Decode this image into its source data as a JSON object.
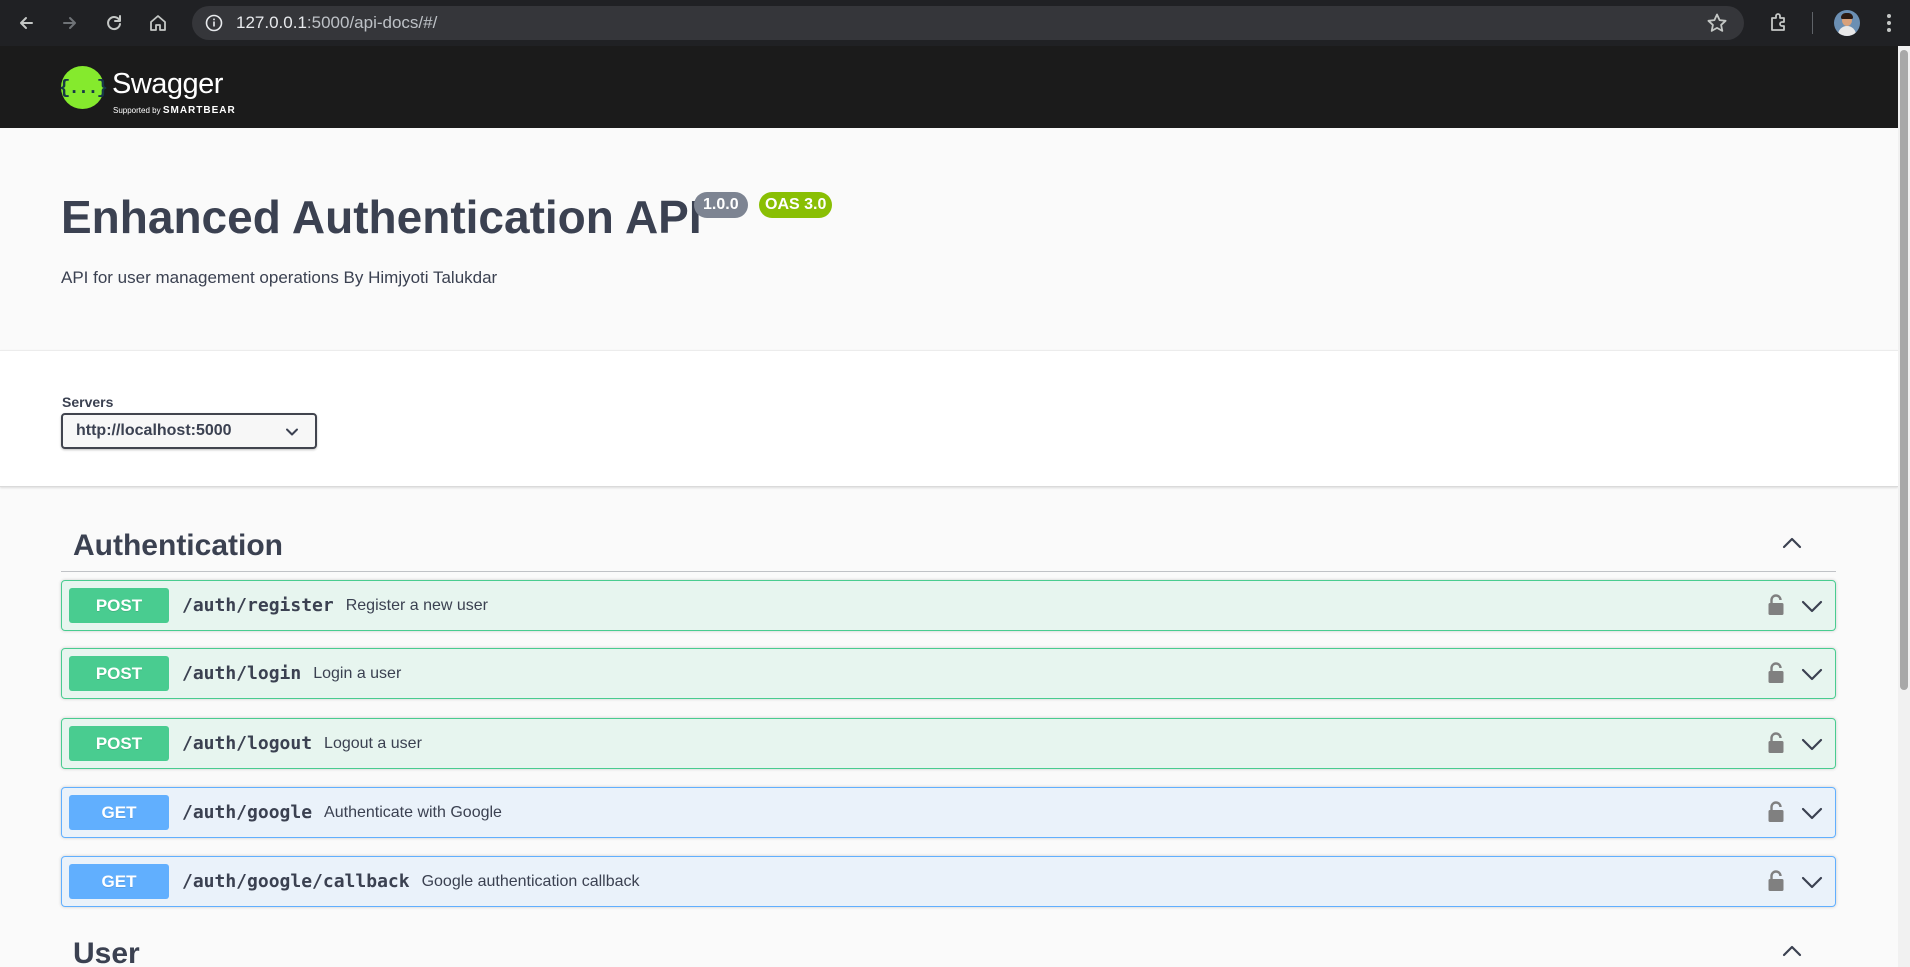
{
  "browser": {
    "url_host": "127.0.0.1",
    "url_rest": ":5000/api-docs/#/"
  },
  "topbar": {
    "logo_symbol": "{...}",
    "logo_text": "Swagger",
    "logo_sub_prefix": "Supported by",
    "logo_sub_brand": "SMARTBEAR"
  },
  "info": {
    "title": "Enhanced Authentication API",
    "version": "1.0.0",
    "oas": "OAS 3.0",
    "description": "API for user management operations By Himjyoti Talukdar"
  },
  "servers": {
    "label": "Servers",
    "selected": "http://localhost:5000"
  },
  "tags": [
    {
      "name": "Authentication",
      "operations": [
        {
          "method": "POST",
          "path": "/auth/register",
          "summary": "Register a new user"
        },
        {
          "method": "POST",
          "path": "/auth/login",
          "summary": "Login a user"
        },
        {
          "method": "POST",
          "path": "/auth/logout",
          "summary": "Logout a user"
        },
        {
          "method": "GET",
          "path": "/auth/google",
          "summary": "Authenticate with Google"
        },
        {
          "method": "GET",
          "path": "/auth/google/callback",
          "summary": "Google authentication callback"
        }
      ]
    },
    {
      "name": "User",
      "operations": []
    }
  ],
  "colors": {
    "post": "#49cc90",
    "get": "#61affe",
    "text": "#3b4151",
    "swagger_green": "#85ea2d"
  },
  "icons": {
    "back": "back-arrow-icon",
    "forward": "forward-arrow-icon",
    "reload": "reload-icon",
    "home": "home-icon",
    "info": "info-icon",
    "star": "star-icon",
    "extensions": "extensions-icon",
    "menu": "kebab-menu-icon",
    "lock": "lock-icon",
    "expand": "chevron-down-icon",
    "collapse": "chevron-up-icon"
  }
}
